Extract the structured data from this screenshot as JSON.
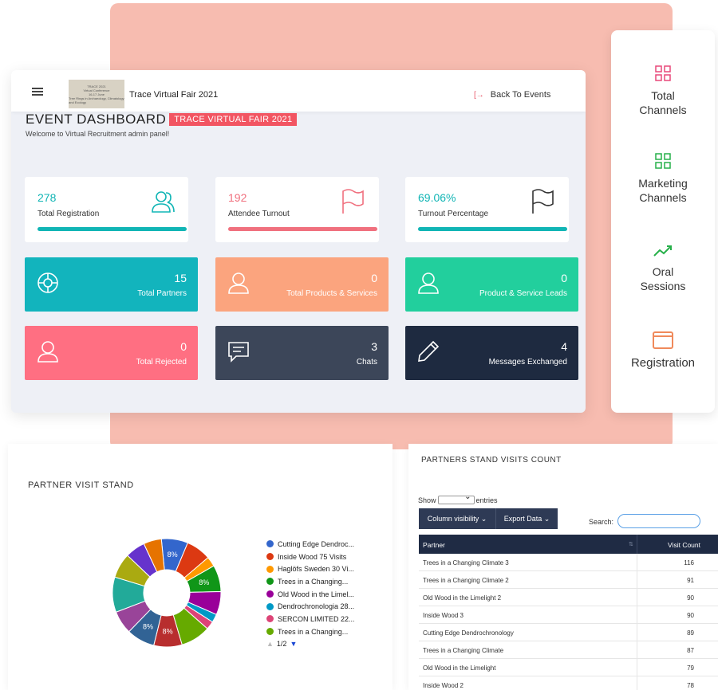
{
  "topbar": {
    "logo_lines": [
      "TRACE 2021",
      "Virtual Conference",
      "16-17 June",
      "Tree Rings in Archaeology, Climatology and Ecology"
    ],
    "event_title": "Trace Virtual Fair 2021",
    "back_label": "Back To Events"
  },
  "header": {
    "title": "EVENT DASHBOARD",
    "badge": "TRACE VIRTUAL FAIR 2021",
    "welcome": "Welcome to Virtual Recruitment admin panel!"
  },
  "stats": [
    {
      "value": "278",
      "label": "Total Registration",
      "color": "#11b5b5",
      "icon": "users-icon"
    },
    {
      "value": "192",
      "label": "Attendee Turnout",
      "color": "#f0707e",
      "icon": "flag-icon"
    },
    {
      "value": "69.06%",
      "label": "Turnout Percentage",
      "color": "#11b5b5",
      "icon": "flag-icon"
    }
  ],
  "tiles": [
    {
      "value": "15",
      "label": "Total Partners",
      "color": "#12b4bd",
      "icon": "lifebuoy-icon"
    },
    {
      "value": "0",
      "label": "Total Products & Services",
      "color": "#fba47e",
      "icon": "user-icon"
    },
    {
      "value": "0",
      "label": "Product & Service Leads",
      "color": "#22cf9d",
      "icon": "user-icon"
    },
    {
      "value": "0",
      "label": "Total Rejected",
      "color": "#ff6f82",
      "icon": "user-icon"
    },
    {
      "value": "3",
      "label": "Chats",
      "color": "#3c4659",
      "icon": "chat-icon"
    },
    {
      "value": "4",
      "label": "Messages Exchanged",
      "color": "#1e2a40",
      "icon": "pencil-icon"
    }
  ],
  "channels": [
    {
      "label_line1": "Total",
      "label_line2": "Channels",
      "icon": "grid-icon",
      "color": "#e8487a"
    },
    {
      "label_line1": "Marketing",
      "label_line2": "Channels",
      "icon": "grid-icon",
      "color": "#27b04a"
    },
    {
      "label_line1": "Oral",
      "label_line2": "Sessions",
      "icon": "trend-icon",
      "color": "#27b04a"
    },
    {
      "label_line1": "Registration",
      "label_line2": "",
      "icon": "window-icon",
      "color": "#f08a5b"
    }
  ],
  "pie_panel": {
    "title": "PARTNER VISIT STAND",
    "pager": "1/2"
  },
  "chart_data": {
    "type": "pie",
    "donut": true,
    "slices": [
      {
        "label": "Cutting Edge Dendroc...",
        "value": 8,
        "color": "#3366cc"
      },
      {
        "label": "Inside Wood 75 Visits",
        "value": 7.5,
        "color": "#dc3912"
      },
      {
        "label": "Haglöfs Sweden 30 Vi...",
        "value": 3,
        "color": "#ff9900"
      },
      {
        "label": "Trees in a Changing...",
        "value": 8,
        "color": "#109618"
      },
      {
        "label": "Old Wood in the Limel...",
        "value": 7,
        "color": "#990099"
      },
      {
        "label": "Dendrochronologia 28...",
        "value": 2.5,
        "color": "#0099c6"
      },
      {
        "label": "SERCON LIMITED 22...",
        "value": 2.5,
        "color": "#dd4477"
      },
      {
        "label": "Trees in a Changing...",
        "value": 9,
        "color": "#66aa00"
      },
      {
        "label": "",
        "value": 8.5,
        "color": "#b82e2e"
      },
      {
        "label": "",
        "value": 8.5,
        "color": "#316395"
      },
      {
        "label": "",
        "value": 7,
        "color": "#994499"
      },
      {
        "label": "",
        "value": 10.6,
        "color": "#22aa99"
      },
      {
        "label": "",
        "value": 7.5,
        "color": "#aaaa11"
      },
      {
        "label": "",
        "value": 6,
        "color": "#6633cc"
      },
      {
        "label": "",
        "value": 5.4,
        "color": "#e67300"
      }
    ],
    "data_labels": [
      "8%",
      "10.6%"
    ]
  },
  "table_panel": {
    "title": "PARTNERS STAND VISITS COUNT",
    "show_label": "Show",
    "entries_label": "entries",
    "column_visibility": "Column visibility ⌄",
    "export_data": "Export Data ⌄",
    "search_label": "Search:",
    "columns": [
      "Partner",
      "Visit Count"
    ],
    "rows": [
      [
        "Trees in a Changing Climate 3",
        "116"
      ],
      [
        "Trees in a Changing Climate 2",
        "91"
      ],
      [
        "Old Wood in the Limelight 2",
        "90"
      ],
      [
        "Inside Wood 3",
        "90"
      ],
      [
        "Cutting Edge Dendrochronology",
        "89"
      ],
      [
        "Trees in a Changing Climate",
        "87"
      ],
      [
        "Old Wood in the Limelight",
        "79"
      ],
      [
        "Inside Wood 2",
        "78"
      ]
    ]
  }
}
